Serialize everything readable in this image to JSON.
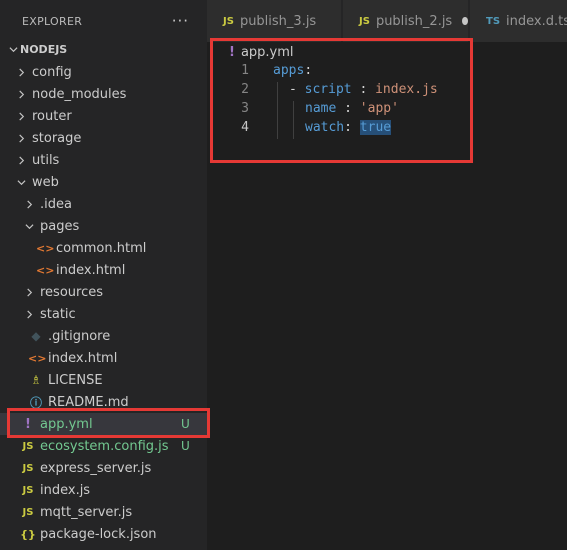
{
  "explorer": {
    "title": "EXPLORER",
    "more_icon": "···",
    "root": "NODEJS",
    "items": [
      {
        "label": "config",
        "kind": "folder",
        "depth": 1,
        "expanded": false
      },
      {
        "label": "node_modules",
        "kind": "folder",
        "depth": 1,
        "expanded": false
      },
      {
        "label": "router",
        "kind": "folder",
        "depth": 1,
        "expanded": false
      },
      {
        "label": "storage",
        "kind": "folder",
        "depth": 1,
        "expanded": false
      },
      {
        "label": "utils",
        "kind": "folder",
        "depth": 1,
        "expanded": false
      },
      {
        "label": "web",
        "kind": "folder",
        "depth": 1,
        "expanded": true
      },
      {
        "label": ".idea",
        "kind": "folder",
        "depth": 2,
        "expanded": false
      },
      {
        "label": "pages",
        "kind": "folder",
        "depth": 2,
        "expanded": true
      },
      {
        "label": "common.html",
        "kind": "html",
        "depth": 3,
        "icon": "<>"
      },
      {
        "label": "index.html",
        "kind": "html",
        "depth": 3,
        "icon": "<>"
      },
      {
        "label": "resources",
        "kind": "folder",
        "depth": 2,
        "expanded": false
      },
      {
        "label": "static",
        "kind": "folder",
        "depth": 2,
        "expanded": false
      },
      {
        "label": ".gitignore",
        "kind": "git",
        "depth": 2,
        "icon": "◆"
      },
      {
        "label": "index.html",
        "kind": "html",
        "depth": 2,
        "icon": "<>"
      },
      {
        "label": "LICENSE",
        "kind": "lic",
        "depth": 2,
        "icon": "♗"
      },
      {
        "label": "README.md",
        "kind": "info",
        "depth": 2,
        "icon": "ⓘ"
      },
      {
        "label": "app.yml",
        "kind": "yml",
        "depth": 1,
        "icon": "!",
        "badge": "U",
        "selected": true,
        "untracked": true
      },
      {
        "label": "ecosystem.config.js",
        "kind": "js",
        "depth": 1,
        "icon": "JS",
        "badge": "U",
        "untracked": true
      },
      {
        "label": "express_server.js",
        "kind": "js",
        "depth": 1,
        "icon": "JS"
      },
      {
        "label": "index.js",
        "kind": "js",
        "depth": 1,
        "icon": "JS"
      },
      {
        "label": "mqtt_server.js",
        "kind": "js",
        "depth": 1,
        "icon": "JS"
      },
      {
        "label": "package-lock.json",
        "kind": "json",
        "depth": 1,
        "icon": "{}"
      }
    ]
  },
  "tabs": [
    {
      "label": "publish_3.js",
      "icon": "JS",
      "kind": "js",
      "dirty": false
    },
    {
      "label": "publish_2.js",
      "icon": "JS",
      "kind": "js",
      "dirty": true
    },
    {
      "label": "index.d.ts",
      "icon": "TS",
      "kind": "ts",
      "dirty": false
    }
  ],
  "editor": {
    "breadcrumb_icon": "!",
    "breadcrumb": "app.yml",
    "line_numbers": [
      "1",
      "2",
      "3",
      "4"
    ],
    "active_line": "4",
    "lines": [
      {
        "key": "apps",
        "sep": ":"
      },
      {
        "dash": "- ",
        "key": "script",
        "sep": " : ",
        "value": "index.js"
      },
      {
        "key": "name",
        "sep": " : ",
        "value": "'app'"
      },
      {
        "key": "watch",
        "sep": ": ",
        "value": "true"
      }
    ]
  },
  "colors": {
    "highlight_box": "#e53935",
    "untracked": "#73c991",
    "selection": "#37373d"
  }
}
